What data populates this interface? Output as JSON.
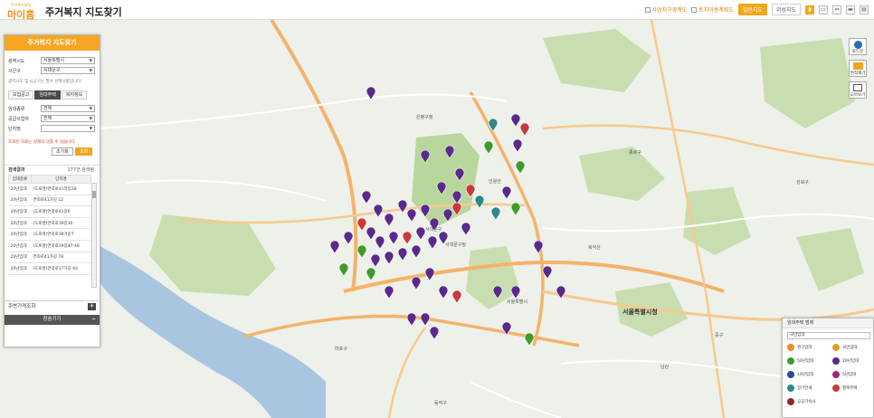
{
  "header": {
    "logo_small": "주거복지포털",
    "logo_main": "마이홈",
    "title": "주거복지 지도찾기",
    "check_business": "사업지구경계도",
    "check_land": "토지이용계획도",
    "btn_normal_map": "일반지도",
    "btn_satellite": "위성지도"
  },
  "panel": {
    "title": "주거복지 지도찾기",
    "region_label": "광역시도",
    "region_value": "서울특별시",
    "district_label": "시군구",
    "district_value": "서대문구",
    "region_note": "광역시도 및 시군구는 필수 선택사항입니다.",
    "tabs": [
      "모집공고",
      "임대주택",
      "복지정보"
    ],
    "type_label": "임대종류",
    "type_value": "전체",
    "provider_label": "공급사업자",
    "provider_value": "전체",
    "complex_label": "단지명",
    "warning": "조회된 자료는 실제와 다를 수 있습니다.",
    "btn_reset": "초기화",
    "btn_search": "조회",
    "result_label": "검색결과",
    "result_count": "177건 검색됨",
    "col_type": "임대종류",
    "col_name": "단지명",
    "rows": [
      [
        "20년임대",
        "(도로명)연희로41라길28"
      ],
      [
        "20년임대",
        "연희로41가길 12"
      ],
      [
        "20년임대",
        "(도로명)연희로41길6"
      ],
      [
        "20년임대",
        "(도로명)연희로39길30"
      ],
      [
        "20년임대",
        "(도로명)연희로39가길7"
      ],
      [
        "20년임대",
        "(도로명)연희로39길47-48"
      ],
      [
        "20년임대",
        "연희로41가길 78"
      ],
      [
        "20년임대",
        "(도로명)연희로17가길 64"
      ]
    ],
    "nearby": "주변가격조회",
    "fold": "창숨기기"
  },
  "right_tools": [
    "로드뷰",
    "면적재기",
    "모아보기"
  ],
  "legend": {
    "title": "임대주택 범례",
    "select": "국민임대",
    "items": [
      {
        "label": "영구임대",
        "color": "#f08a24"
      },
      {
        "label": "국민임대",
        "color": "#e0a020"
      },
      {
        "label": "50년임대",
        "color": "#3f9b2a"
      },
      {
        "label": "20년임대",
        "color": "#5a2a8a"
      },
      {
        "label": "10년임대",
        "color": "#2a4a9a"
      },
      {
        "label": "5년임대",
        "color": "#9a2a7a"
      },
      {
        "label": "장기전세",
        "color": "#2a8a8a"
      },
      {
        "label": "행복주택",
        "color": "#c83a3a"
      },
      {
        "label": "공공기숙사",
        "color": "#8a2a2a"
      }
    ]
  },
  "map_labels": [
    "은평구청",
    "서대문구",
    "서대문구청",
    "종로구",
    "성북구",
    "서울특별시청",
    "마포구",
    "중구",
    "동작구",
    "서울특별시",
    "북악산",
    "인왕산",
    "남산"
  ]
}
